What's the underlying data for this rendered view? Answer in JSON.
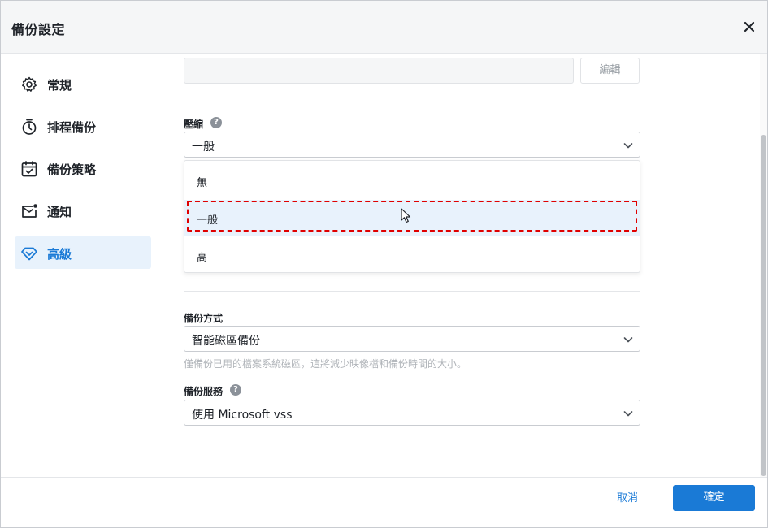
{
  "window": {
    "title": "備份設定"
  },
  "sidebar": {
    "items": [
      {
        "label": "常規",
        "icon": "gear-icon"
      },
      {
        "label": "排程備份",
        "icon": "timer-icon"
      },
      {
        "label": "備份策略",
        "icon": "calendar-check-icon"
      },
      {
        "label": "通知",
        "icon": "mail-icon"
      },
      {
        "label": "高級",
        "icon": "diamond-icon"
      }
    ],
    "active_index": 4
  },
  "main": {
    "edit_label": "編輯",
    "compression": {
      "label": "壓縮",
      "help": "?",
      "value": "一般",
      "options": [
        "無",
        "一般",
        "高"
      ],
      "highlighted_option": "一般"
    },
    "backup_mode": {
      "label": "備份方式",
      "value": "智能磁區備份",
      "hint": "僅備份已用的檔案系統磁區，這將減少映像檔和備份時間的大小。"
    },
    "backup_service": {
      "label": "備份服務",
      "help": "?",
      "value": "使用 Microsoft vss"
    }
  },
  "footer": {
    "cancel_label": "取消",
    "ok_label": "確定"
  },
  "colors": {
    "accent": "#1a7ad6",
    "active_bg": "#e8f2fc",
    "highlight_border": "#e00000"
  }
}
